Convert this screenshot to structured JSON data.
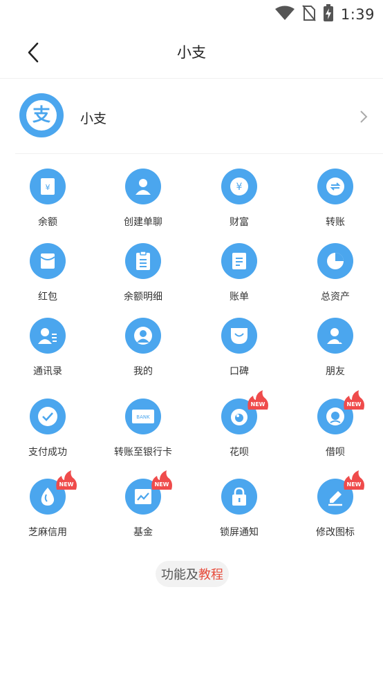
{
  "status_bar": {
    "time": "1:39",
    "icons": [
      "wifi-icon",
      "no-sim-icon",
      "battery-charging-icon"
    ]
  },
  "nav": {
    "title": "小支",
    "back_icon": "back-chevron-icon"
  },
  "profile": {
    "name": "小支",
    "avatar_icon": "alipay-logo-icon",
    "avatar_glyph": "支"
  },
  "grid": {
    "rows": [
      [
        {
          "label": "余额",
          "icon": "balance-icon",
          "new": false
        },
        {
          "label": "创建单聊",
          "icon": "user-icon",
          "new": false
        },
        {
          "label": "财富",
          "icon": "yuan-coin-icon",
          "new": false
        },
        {
          "label": "转账",
          "icon": "transfer-icon",
          "new": false
        }
      ],
      [
        {
          "label": "红包",
          "icon": "red-envelope-icon",
          "new": false
        },
        {
          "label": "余额明细",
          "icon": "clipboard-icon",
          "new": false
        },
        {
          "label": "账单",
          "icon": "bill-icon",
          "new": false
        },
        {
          "label": "总资产",
          "icon": "pie-chart-icon",
          "new": false
        }
      ],
      [
        {
          "label": "通讯录",
          "icon": "contacts-icon",
          "new": false
        },
        {
          "label": "我的",
          "icon": "profile-icon",
          "new": false
        },
        {
          "label": "口碑",
          "icon": "koubei-icon",
          "new": false
        },
        {
          "label": "朋友",
          "icon": "friends-icon",
          "new": false
        }
      ],
      [
        {
          "label": "支付成功",
          "icon": "check-circle-icon",
          "new": false
        },
        {
          "label": "转账至银行卡",
          "icon": "bank-card-icon",
          "new": false,
          "card_text": "BANK"
        },
        {
          "label": "花呗",
          "icon": "huabei-icon",
          "new": true
        },
        {
          "label": "借呗",
          "icon": "jiebei-icon",
          "new": true
        }
      ],
      [
        {
          "label": "芝麻信用",
          "icon": "sesame-credit-icon",
          "new": true
        },
        {
          "label": "基金",
          "icon": "fund-chart-icon",
          "new": true
        },
        {
          "label": "锁屏通知",
          "icon": "lock-icon",
          "new": false
        },
        {
          "label": "修改图标",
          "icon": "edit-pencil-icon",
          "new": true
        }
      ]
    ],
    "new_badge_text": "NEW"
  },
  "footer": {
    "text_a": "功能及",
    "text_b": "教程"
  },
  "colors": {
    "accent_blue": "#4ba6ee",
    "badge_red": "#ef4b4b",
    "footer_highlight": "#e74c3c"
  }
}
